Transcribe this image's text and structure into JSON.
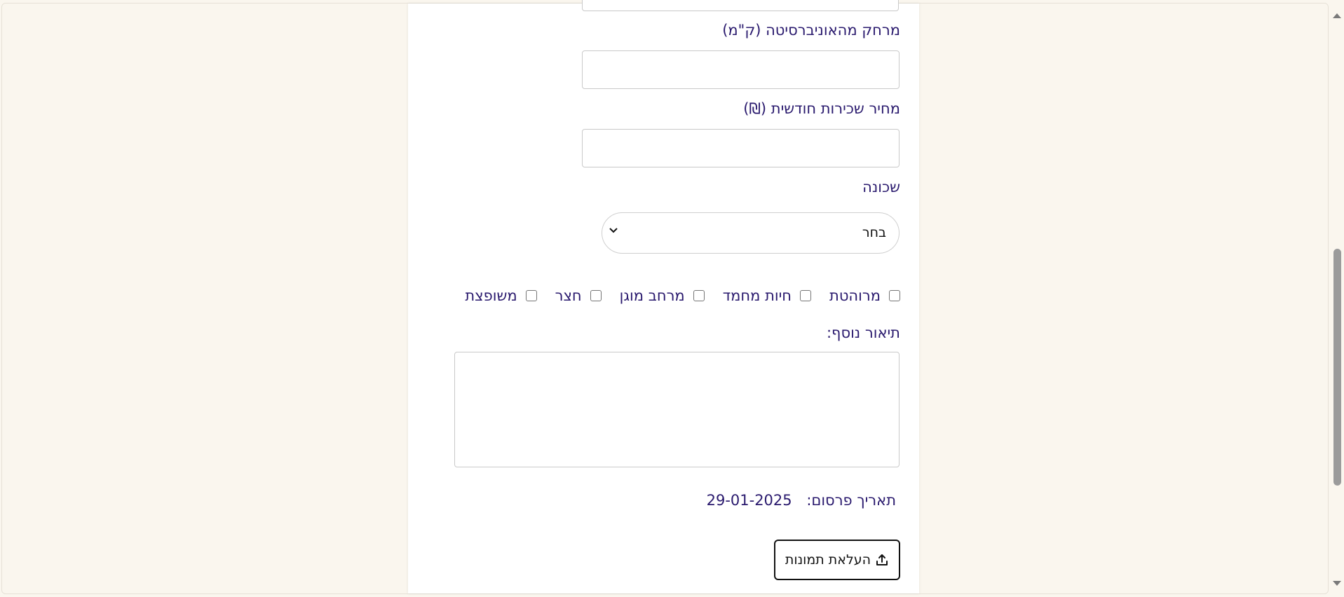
{
  "form": {
    "distance_label": "מרחק מהאוניברסיטה (ק\"מ)",
    "distance_value": "",
    "rent_label": "מחיר שכירות חודשית (₪)",
    "rent_value": "",
    "neighborhood_label": "שכונה",
    "neighborhood_selected": "בחר",
    "amenities": [
      {
        "label": "מרוהטת",
        "checked": false
      },
      {
        "label": "חיות מחמד",
        "checked": false
      },
      {
        "label": "מרחב מוגן",
        "checked": false
      },
      {
        "label": "חצר",
        "checked": false
      },
      {
        "label": "משופצת",
        "checked": false
      }
    ],
    "description_label": "תיאור נוסף:",
    "description_value": "",
    "publish_date_label": "תאריך פרסום:",
    "publish_date_value": "29-01-2025",
    "upload_button_label": "העלאת תמונות"
  },
  "colors": {
    "label_text": "#2a1a6e",
    "page_background": "#faf6ee",
    "panel_background": "#ffffff"
  },
  "icons": {
    "select_arrow": "chevron-down-icon",
    "upload": "upload-icon",
    "scroll_up": "scroll-up-arrow-icon",
    "scroll_down": "scroll-down-arrow-icon"
  }
}
